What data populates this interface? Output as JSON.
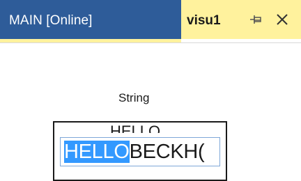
{
  "tabs": {
    "main_label": "MAIN [Online]",
    "visu_label": "visu1",
    "pin_icon": "pin-icon",
    "close_icon": "close-icon"
  },
  "visu": {
    "string_label": "String",
    "ghost_value": "HELLO",
    "input_selected": "HELLO",
    "input_rest": "BECKH("
  },
  "colors": {
    "active_tab_bg": "#2e5c99",
    "visu_tab_bg": "#fff29d",
    "selection": "#3399ff"
  }
}
